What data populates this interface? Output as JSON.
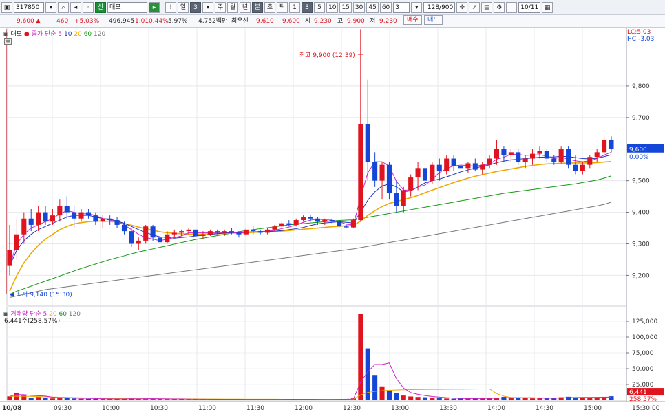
{
  "toolbar": {
    "code": "317850",
    "badge": "신",
    "name": "대모",
    "period_buttons": [
      "!",
      "일",
      "3",
      "주",
      "월",
      "년",
      "분",
      "초",
      "틱",
      "1",
      "3",
      "5",
      "10",
      "15",
      "30",
      "45",
      "60"
    ],
    "selected_period": "3",
    "interval_value": "3",
    "count": "128/900",
    "date": "10/11"
  },
  "priceinfo": {
    "price": "9,600",
    "change": "460",
    "change_pct": "+5.03%",
    "volume": "496,945",
    "volume_pct": "1,010.44%",
    "turnover_rate": "5.97%",
    "amount": "4,752백만",
    "best_label": "최우선",
    "best_ask": "9,610",
    "best_bid": "9,600",
    "open_label": "시",
    "open": "9,230",
    "high_label": "고",
    "high": "9,900",
    "low_label": "저",
    "low": "9,230",
    "buy_label": "매수",
    "sell_label": "매도"
  },
  "legend": {
    "name": "대모",
    "ma_label": "종가 단순",
    "ma_periods": [
      "5",
      "10",
      "20",
      "60",
      "120"
    ],
    "lc": "LC:5.03",
    "hc": "HC:-3.03",
    "vol_label": "거래량 단순",
    "vol_periods": [
      "5",
      "20",
      "60",
      "120"
    ],
    "vol_value": "6,441주(258.57%)"
  },
  "annotations": {
    "high": "최고 9,900 (12:39)",
    "low": "최저 9,140 (15:30)"
  },
  "colors": {
    "up": "#e0141e",
    "down": "#1447d8",
    "ma5": "#cc22cc",
    "ma10": "#2233bb",
    "ma20": "#f0a800",
    "ma60": "#119911",
    "ma120": "#777777"
  },
  "chart_data": {
    "type": "candlestick",
    "price_axis": {
      "ticks": [
        "9,800",
        "9,700",
        "9,600",
        "9,500",
        "9,400",
        "9,300",
        "9,200"
      ],
      "range": [
        9105,
        9985
      ]
    },
    "current_price_label": "9,600",
    "current_pct_label": "0.00%",
    "volume_axis": {
      "ticks": [
        "125,000",
        "100,000",
        "75,000",
        "50,000",
        "25,000"
      ],
      "max": 137000
    },
    "current_volume_label": "6,441",
    "current_volume_pct_label": "258.57%",
    "time_axis": [
      "10/08",
      "09:30",
      "10:00",
      "10:30",
      "11:00",
      "11:30",
      "12:00",
      "12:30",
      "13:00",
      "13:30",
      "14:00",
      "14:30",
      "15:00",
      "15:30:00"
    ],
    "ohlc": [
      [
        9230,
        9360,
        9200,
        9280
      ],
      [
        9280,
        9380,
        9250,
        9330
      ],
      [
        9330,
        9400,
        9300,
        9380
      ],
      [
        9380,
        9410,
        9340,
        9360
      ],
      [
        9360,
        9420,
        9340,
        9400
      ],
      [
        9400,
        9420,
        9360,
        9370
      ],
      [
        9370,
        9410,
        9360,
        9390
      ],
      [
        9390,
        9440,
        9370,
        9420
      ],
      [
        9420,
        9450,
        9380,
        9400
      ],
      [
        9400,
        9420,
        9350,
        9380
      ],
      [
        9380,
        9410,
        9370,
        9400
      ],
      [
        9400,
        9410,
        9380,
        9390
      ],
      [
        9390,
        9400,
        9360,
        9370
      ],
      [
        9370,
        9390,
        9350,
        9380
      ],
      [
        9380,
        9390,
        9360,
        9375
      ],
      [
        9375,
        9385,
        9350,
        9360
      ],
      [
        9360,
        9370,
        9330,
        9340
      ],
      [
        9340,
        9350,
        9290,
        9300
      ],
      [
        9300,
        9320,
        9280,
        9310
      ],
      [
        9310,
        9360,
        9300,
        9355
      ],
      [
        9355,
        9360,
        9310,
        9320
      ],
      [
        9320,
        9330,
        9300,
        9305
      ],
      [
        9305,
        9340,
        9300,
        9330
      ],
      [
        9330,
        9345,
        9320,
        9335
      ],
      [
        9335,
        9345,
        9325,
        9340
      ],
      [
        9340,
        9350,
        9330,
        9345
      ],
      [
        9345,
        9350,
        9320,
        9325
      ],
      [
        9325,
        9340,
        9315,
        9330
      ],
      [
        9330,
        9345,
        9325,
        9340
      ],
      [
        9340,
        9345,
        9330,
        9335
      ],
      [
        9335,
        9345,
        9325,
        9340
      ],
      [
        9340,
        9350,
        9330,
        9335
      ],
      [
        9335,
        9340,
        9320,
        9330
      ],
      [
        9330,
        9350,
        9325,
        9345
      ],
      [
        9345,
        9355,
        9330,
        9340
      ],
      [
        9340,
        9345,
        9330,
        9335
      ],
      [
        9335,
        9350,
        9330,
        9345
      ],
      [
        9345,
        9360,
        9340,
        9355
      ],
      [
        9355,
        9370,
        9350,
        9365
      ],
      [
        9365,
        9375,
        9355,
        9360
      ],
      [
        9360,
        9380,
        9355,
        9375
      ],
      [
        9375,
        9390,
        9370,
        9385
      ],
      [
        9385,
        9390,
        9370,
        9380
      ],
      [
        9380,
        9385,
        9360,
        9370
      ],
      [
        9370,
        9380,
        9360,
        9375
      ],
      [
        9375,
        9380,
        9365,
        9370
      ],
      [
        9370,
        9375,
        9350,
        9355
      ],
      [
        9355,
        9360,
        9350,
        9352
      ],
      [
        9352,
        9380,
        9350,
        9375
      ],
      [
        9375,
        9900,
        9370,
        9680
      ],
      [
        9680,
        9820,
        9500,
        9560
      ],
      [
        9560,
        9590,
        9480,
        9500
      ],
      [
        9500,
        9560,
        9440,
        9550
      ],
      [
        9550,
        9560,
        9440,
        9460
      ],
      [
        9460,
        9500,
        9400,
        9420
      ],
      [
        9420,
        9480,
        9400,
        9470
      ],
      [
        9470,
        9520,
        9450,
        9510
      ],
      [
        9510,
        9560,
        9470,
        9540
      ],
      [
        9540,
        9560,
        9480,
        9500
      ],
      [
        9500,
        9560,
        9490,
        9550
      ],
      [
        9550,
        9570,
        9500,
        9530
      ],
      [
        9530,
        9580,
        9520,
        9570
      ],
      [
        9570,
        9580,
        9530,
        9545
      ],
      [
        9545,
        9560,
        9520,
        9540
      ],
      [
        9540,
        9560,
        9525,
        9555
      ],
      [
        9555,
        9570,
        9530,
        9535
      ],
      [
        9535,
        9560,
        9520,
        9550
      ],
      [
        9550,
        9580,
        9540,
        9570
      ],
      [
        9570,
        9630,
        9550,
        9600
      ],
      [
        9600,
        9610,
        9560,
        9580
      ],
      [
        9580,
        9600,
        9560,
        9590
      ],
      [
        9590,
        9600,
        9550,
        9560
      ],
      [
        9560,
        9580,
        9540,
        9570
      ],
      [
        9570,
        9600,
        9550,
        9585
      ],
      [
        9585,
        9610,
        9570,
        9595
      ],
      [
        9595,
        9600,
        9560,
        9570
      ],
      [
        9570,
        9580,
        9550,
        9560
      ],
      [
        9560,
        9610,
        9555,
        9600
      ],
      [
        9600,
        9610,
        9540,
        9550
      ],
      [
        9550,
        9580,
        9520,
        9530
      ],
      [
        9530,
        9560,
        9520,
        9550
      ],
      [
        9550,
        9580,
        9540,
        9575
      ],
      [
        9575,
        9600,
        9560,
        9590
      ],
      [
        9590,
        9640,
        9580,
        9630
      ],
      [
        9630,
        9640,
        9590,
        9600
      ]
    ],
    "ma5": [
      9230,
      9300,
      9330,
      9350,
      9360,
      9370,
      9380,
      9395,
      9405,
      9400,
      9395,
      9395,
      9390,
      9380,
      9375,
      9370,
      9360,
      9345,
      9330,
      9320,
      9315,
      9310,
      9315,
      9320,
      9325,
      9335,
      9335,
      9335,
      9335,
      9335,
      9336,
      9336,
      9334,
      9336,
      9338,
      9339,
      9340,
      9343,
      9348,
      9353,
      9360,
      9368,
      9375,
      9378,
      9376,
      9375,
      9370,
      9362,
      9360,
      9447,
      9525,
      9560,
      9560,
      9546,
      9498,
      9470,
      9470,
      9480,
      9486,
      9504,
      9526,
      9538,
      9547,
      9549,
      9548,
      9545,
      9550,
      9552,
      9568,
      9574,
      9584,
      9583,
      9580,
      9581,
      9582,
      9578,
      9570,
      9574,
      9568,
      9563,
      9560,
      9563,
      9570,
      9581,
      9590
    ],
    "ma10": [
      9230,
      9280,
      9310,
      9330,
      9345,
      9355,
      9365,
      9375,
      9385,
      9390,
      9390,
      9390,
      9385,
      9380,
      9378,
      9372,
      9365,
      9355,
      9345,
      9336,
      9328,
      9322,
      9320,
      9318,
      9320,
      9322,
      9325,
      9327,
      9330,
      9332,
      9334,
      9335,
      9336,
      9337,
      9338,
      9338,
      9339,
      9340,
      9342,
      9345,
      9348,
      9352,
      9358,
      9363,
      9366,
      9368,
      9370,
      9368,
      9366,
      9400,
      9438,
      9465,
      9483,
      9490,
      9480,
      9465,
      9468,
      9480,
      9493,
      9500,
      9505,
      9512,
      9520,
      9528,
      9534,
      9540,
      9545,
      9550,
      9557,
      9562,
      9566,
      9568,
      9570,
      9572,
      9574,
      9575,
      9575,
      9577,
      9576,
      9573,
      9570,
      9569,
      9571,
      9576,
      9582
    ],
    "ma20": [
      9150,
      9200,
      9240,
      9270,
      9295,
      9315,
      9330,
      9345,
      9355,
      9363,
      9367,
      9370,
      9372,
      9372,
      9371,
      9368,
      9364,
      9359,
      9353,
      9348,
      9343,
      9338,
      9335,
      9333,
      9332,
      9331,
      9331,
      9331,
      9332,
      9332,
      9333,
      9334,
      9334,
      9335,
      9336,
      9337,
      9338,
      9339,
      9340,
      9342,
      9344,
      9346,
      9348,
      9350,
      9352,
      9354,
      9356,
      9357,
      9358,
      9372,
      9390,
      9405,
      9418,
      9428,
      9434,
      9440,
      9446,
      9453,
      9462,
      9470,
      9478,
      9486,
      9494,
      9501,
      9508,
      9514,
      9519,
      9524,
      9529,
      9533,
      9537,
      9541,
      9545,
      9548,
      9551,
      9553,
      9554,
      9555,
      9556,
      9556,
      9556,
      9556,
      9557,
      9559,
      9561
    ],
    "ma60": [
      9140,
      9150,
      9158,
      9166,
      9174,
      9182,
      9190,
      9198,
      9206,
      9214,
      9222,
      9229,
      9236,
      9243,
      9250,
      9256,
      9262,
      9268,
      9274,
      9279,
      9284,
      9289,
      9294,
      9299,
      9304,
      9309,
      9314,
      9318,
      9322,
      9326,
      9330,
      9334,
      9338,
      9342,
      9345,
      9348,
      9351,
      9354,
      9357,
      9360,
      9362,
      9364,
      9366,
      9368,
      9370,
      9372,
      9374,
      9375,
      9376,
      9380,
      9384,
      9388,
      9392,
      9396,
      9400,
      9404,
      9408,
      9412,
      9416,
      9420,
      9424,
      9428,
      9432,
      9436,
      9440,
      9444,
      9448,
      9452,
      9456,
      9460,
      9463,
      9466,
      9469,
      9472,
      9475,
      9478,
      9481,
      9484,
      9487,
      9490,
      9494,
      9498,
      9502,
      9508,
      9515
    ],
    "ma120": [
      9130,
      9135,
      9140,
      9145,
      9150,
      9155,
      9158,
      9161,
      9164,
      9167,
      9170,
      9173,
      9176,
      9179,
      9182,
      9185,
      9188,
      9191,
      9194,
      9197,
      9200,
      9203,
      9206,
      9209,
      9212,
      9215,
      9218,
      9221,
      9224,
      9227,
      9230,
      9233,
      9236,
      9239,
      9242,
      9245,
      9248,
      9251,
      9254,
      9257,
      9260,
      9263,
      9266,
      9269,
      9272,
      9275,
      9278,
      9281,
      9284,
      9288,
      9292,
      9296,
      9300,
      9304,
      9308,
      9312,
      9316,
      9320,
      9324,
      9328,
      9332,
      9336,
      9340,
      9344,
      9348,
      9352,
      9356,
      9360,
      9364,
      9368,
      9372,
      9376,
      9380,
      9384,
      9388,
      9392,
      9396,
      9400,
      9404,
      9408,
      9412,
      9416,
      9420,
      9425,
      9432
    ],
    "volume": [
      6200,
      12000,
      8500,
      4000,
      5200,
      3500,
      3000,
      4200,
      3800,
      2900,
      2500,
      2400,
      2300,
      2100,
      2000,
      1900,
      2600,
      3100,
      2200,
      2800,
      2300,
      2100,
      1900,
      1800,
      1700,
      1600,
      1800,
      1700,
      1600,
      1500,
      1700,
      1600,
      1500,
      1400,
      1500,
      1700,
      1600,
      1500,
      1600,
      1800,
      1700,
      1500,
      1400,
      1300,
      1200,
      1500,
      1900,
      2200,
      3100,
      136000,
      82000,
      40000,
      22000,
      16000,
      11000,
      7500,
      6000,
      5200,
      4800,
      3900,
      3200,
      2900,
      2600,
      2800,
      3100,
      2900,
      3300,
      3600,
      4200,
      5400,
      3900,
      3500,
      3400,
      3100,
      3300,
      3600,
      3900,
      4800,
      5600,
      4600,
      3900,
      4200,
      4800,
      5500,
      6441
    ],
    "vol_ma5": [
      6200,
      9100,
      8900,
      7700,
      7180,
      6640,
      4840,
      3980,
      3900,
      3480,
      3300,
      3160,
      2780,
      2440,
      2260,
      2140,
      2180,
      2400,
      2360,
      2520,
      2600,
      2500,
      2260,
      2220,
      2120,
      1840,
      1760,
      1720,
      1680,
      1640,
      1660,
      1620,
      1620,
      1560,
      1540,
      1540,
      1560,
      1560,
      1560,
      1640,
      1660,
      1620,
      1600,
      1540,
      1420,
      1420,
      1460,
      1660,
      1980,
      28800,
      45000,
      56600,
      56600,
      59000,
      34200,
      19300,
      12100,
      9340,
      7500,
      6020,
      5040,
      4200,
      3480,
      3080,
      2920,
      2860,
      2940,
      3060,
      3380,
      3880,
      4080,
      4120,
      4080,
      4060,
      3440,
      3380,
      3460,
      3820,
      4240,
      4500,
      4560,
      4620,
      4700,
      4940,
      5100
    ],
    "vol_ma20": [
      6000,
      6500,
      6400,
      6100,
      5800,
      5500,
      5200,
      4900,
      4600,
      4300,
      4000,
      3800,
      3500,
      3200,
      3000,
      2800,
      2700,
      2600,
      2550,
      2500,
      2450,
      2400,
      2350,
      2300,
      2250,
      2200,
      2150,
      2100,
      2050,
      2000,
      1950,
      1900,
      1850,
      1800,
      1750,
      1700,
      1700,
      1700,
      1650,
      1650,
      1650,
      1600,
      1600,
      1600,
      1600,
      1600,
      1600,
      1650,
      1700,
      8300,
      12300,
      14200,
      15100,
      15800,
      16300,
      16600,
      16800,
      17000,
      17100,
      17200,
      17300,
      17400,
      17500,
      17600,
      17700,
      17800,
      17900,
      18000,
      10500,
      6500,
      4500,
      4200,
      4100,
      4000,
      3900,
      3850,
      3800,
      3800,
      3850,
      3900,
      3950,
      4000,
      4050,
      4100,
      4150
    ]
  }
}
